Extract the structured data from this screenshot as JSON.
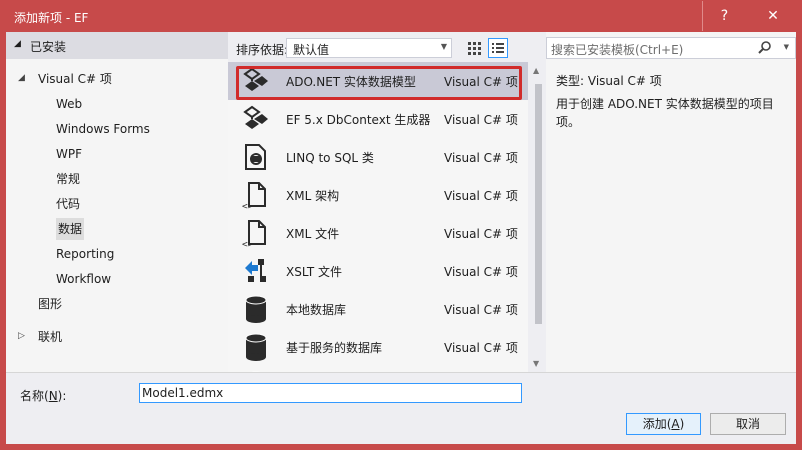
{
  "window": {
    "title": "添加新项 - EF",
    "help_label": "?",
    "close_label": "✕"
  },
  "left": {
    "header": "已安装",
    "tree": [
      {
        "label": "Visual C# 项",
        "level": 0,
        "expanded": true
      },
      {
        "label": "Web",
        "level": 1
      },
      {
        "label": "Windows Forms",
        "level": 1
      },
      {
        "label": "WPF",
        "level": 1
      },
      {
        "label": "常规",
        "level": 1
      },
      {
        "label": "代码",
        "level": 1
      },
      {
        "label": "数据",
        "level": 1,
        "selected": true
      },
      {
        "label": "Reporting",
        "level": 1
      },
      {
        "label": "Workflow",
        "level": 1
      },
      {
        "label": "图形",
        "level": 0
      },
      {
        "label": "联机",
        "level": 0,
        "expanded": false
      }
    ]
  },
  "sortbar": {
    "label": "排序依据:",
    "value": "默认值"
  },
  "items": [
    {
      "name": "ADO.NET 实体数据模型",
      "lang": "Visual C# 项",
      "icon": "entity-model-icon",
      "selected": true
    },
    {
      "name": "EF 5.x DbContext 生成器",
      "lang": "Visual C# 项",
      "icon": "dbcontext-generator-icon"
    },
    {
      "name": "LINQ to SQL 类",
      "lang": "Visual C# 项",
      "icon": "linq-to-sql-icon"
    },
    {
      "name": "XML 架构",
      "lang": "Visual C# 项",
      "icon": "xml-schema-icon"
    },
    {
      "name": "XML 文件",
      "lang": "Visual C# 项",
      "icon": "xml-file-icon"
    },
    {
      "name": "XSLT 文件",
      "lang": "Visual C# 项",
      "icon": "xslt-file-icon"
    },
    {
      "name": "本地数据库",
      "lang": "Visual C# 项",
      "icon": "local-database-icon"
    },
    {
      "name": "基于服务的数据库",
      "lang": "Visual C# 项",
      "icon": "service-database-icon"
    }
  ],
  "right": {
    "search_placeholder": "搜索已安装模板(Ctrl+E)",
    "type_label": "类型:",
    "type_value": "Visual C# 项",
    "description": "用于创建 ADO.NET 实体数据模型的项目项。"
  },
  "bottom": {
    "name_label_text": "名称(",
    "name_label_key": "N",
    "name_label_end": "):",
    "name_value": "Model1.edmx",
    "add_text": "添加(",
    "add_key": "A",
    "add_end": ")",
    "cancel_label": "取消"
  },
  "colors": {
    "titlebar": "#c74a4a",
    "highlight_border": "#d12b2b",
    "selection": "#c9c9d6",
    "focus_border": "#3399ff"
  }
}
